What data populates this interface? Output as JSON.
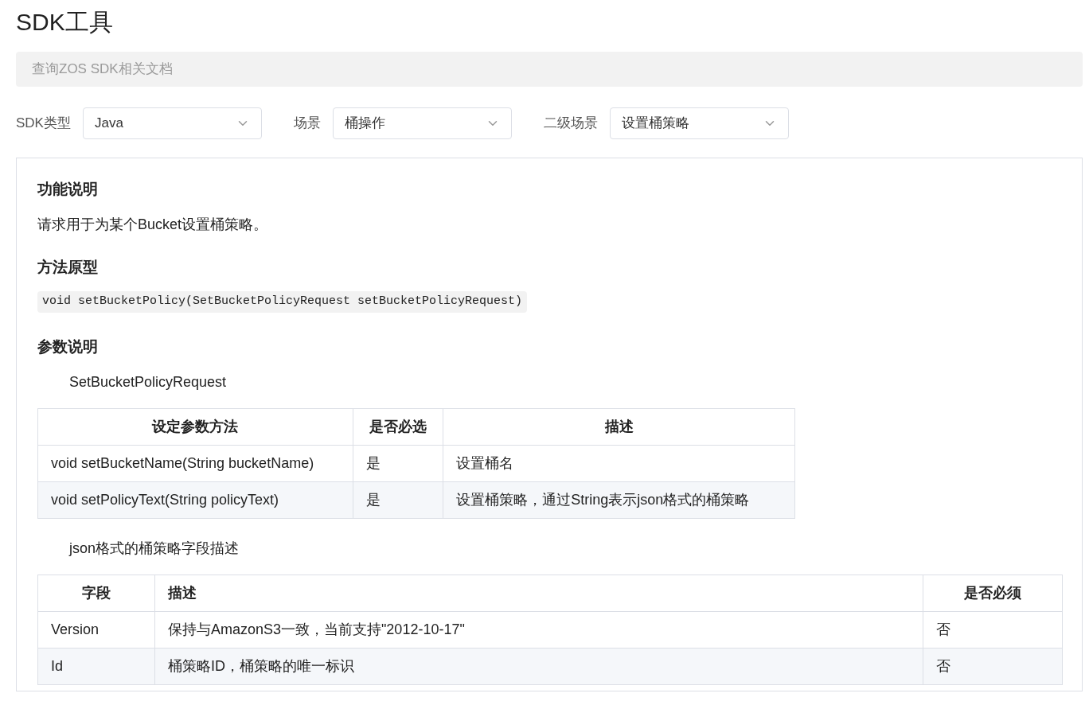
{
  "title": "SDK工具",
  "search": {
    "placeholder": "查询ZOS SDK相关文档"
  },
  "filters": [
    {
      "label": "SDK类型",
      "value": "Java"
    },
    {
      "label": "场景",
      "value": "桶操作"
    },
    {
      "label": "二级场景",
      "value": "设置桶策略"
    }
  ],
  "blocks": [
    {
      "kind": "heading",
      "text": "功能说明"
    },
    {
      "kind": "paragraph",
      "text": "请求用于为某个Bucket设置桶策略。"
    },
    {
      "kind": "heading",
      "text": "方法原型"
    },
    {
      "kind": "code",
      "text": "void setBucketPolicy(SetBucketPolicyRequest setBucketPolicyRequest)"
    },
    {
      "kind": "heading",
      "text": "参数说明"
    },
    {
      "kind": "caption",
      "text": "SetBucketPolicyRequest"
    },
    {
      "kind": "table",
      "wide": false,
      "columns": [
        {
          "label": "设定参数方法",
          "centered": true
        },
        {
          "label": "是否必选",
          "centered": true
        },
        {
          "label": "描述",
          "centered": true
        }
      ],
      "rows": [
        [
          "void setBucketName(String bucketName)",
          "是",
          "设置桶名"
        ],
        [
          "void setPolicyText(String policyText)",
          "是",
          "设置桶策略，通过String表示json格式的桶策略"
        ]
      ]
    },
    {
      "kind": "caption",
      "text": "json格式的桶策略字段描述"
    },
    {
      "kind": "table",
      "wide": true,
      "columns": [
        {
          "label": "字段",
          "centered": true
        },
        {
          "label": "描述",
          "centered": false
        },
        {
          "label": "是否必须",
          "centered": true
        }
      ],
      "rows": [
        [
          "Version",
          "保持与AmazonS3一致，当前支持\"2012-10-17\"",
          "否"
        ],
        [
          "Id",
          "桶策略ID，桶策略的唯一标识",
          "否"
        ]
      ]
    }
  ]
}
